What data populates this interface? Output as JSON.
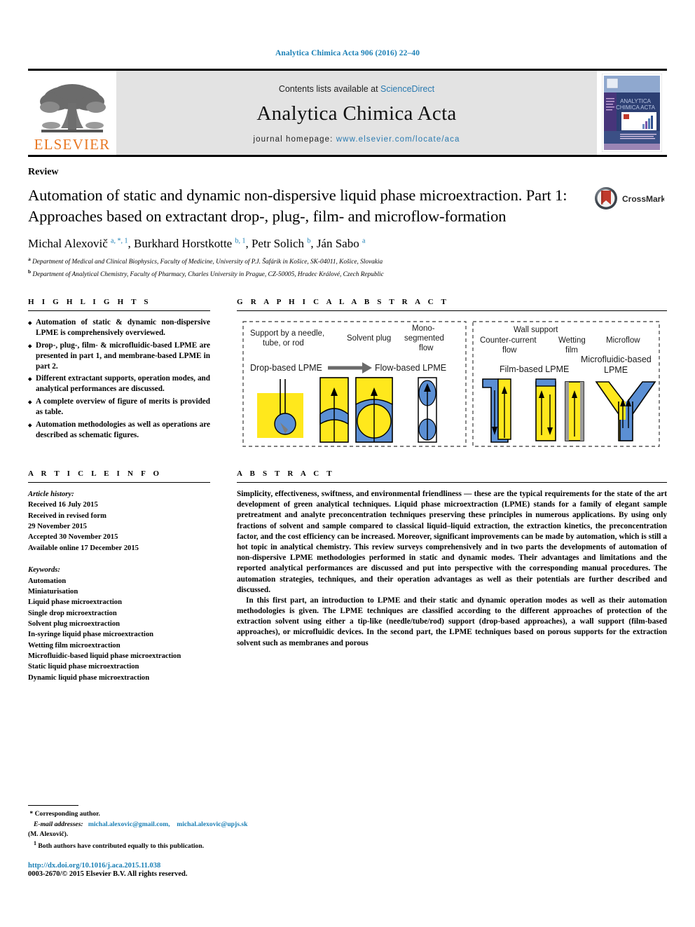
{
  "running_head": "Analytica Chimica Acta 906 (2016) 22–40",
  "masthead": {
    "publisher": "ELSEVIER",
    "contents_prefix": "Contents lists available at ",
    "contents_link": "ScienceDirect",
    "journal_name": "Analytica Chimica Acta",
    "homepage_prefix": "journal homepage: ",
    "homepage_url": "www.elsevier.com/locate/aca",
    "cover_title": "ANALYTICA CHIMICA ACTA"
  },
  "article": {
    "type_label": "Review",
    "title": "Automation of static and dynamic non-dispersive liquid phase microextraction. Part 1: Approaches based on extractant drop-, plug-, film- and microflow-formation",
    "crossmark_label": "CrossMark",
    "authors_html": "Michal Alexovič <sup>a, *, 1</sup>, Burkhard Horstkotte <sup>b, 1</sup>, Petr Solich <sup>b</sup>, Ján Sabo <sup>a</sup>",
    "affiliation_a": "Department of Medical and Clinical Biophysics, Faculty of Medicine, University of P.J. Šafárik in Košice, SK-04011, Košice, Slovakia",
    "affiliation_b": "Department of Analytical Chemistry, Faculty of Pharmacy, Charles University in Prague, CZ-50005, Hradec Králové, Czech Republic"
  },
  "highlights": {
    "heading": "H I G H L I G H T S",
    "items": [
      "Automation of static & dynamic non-dispersive LPME is comprehensively overviewed.",
      "Drop-, plug-, film- & microfluidic-based LPME are presented in part 1, and membrane-based LPME in part 2.",
      "Different extractant supports, operation modes, and analytical performances are discussed.",
      "A complete overview of figure of merits is provided as table.",
      "Automation methodologies as well as operations are described as schematic figures."
    ]
  },
  "graphical_abstract": {
    "heading": "G R A P H I C A L   A B S T R A C T",
    "left_panel": {
      "label_needle": "Support by a needle, tube, or rod",
      "label_solvent_plug": "Solvent plug",
      "label_mono": "Mono-segmented flow",
      "label_drop_based": "Drop-based LPME",
      "label_flow_based": "Flow-based LPME"
    },
    "right_panel": {
      "label_wall_support": "Wall support",
      "label_counter_current": "Counter-current flow",
      "label_wetting_film": "Wetting film",
      "label_microflow": "Microflow",
      "label_film_based": "Film-based LPME",
      "label_microfluidic": "Microfluidic-based LPME"
    },
    "colors": {
      "sample": "#FFE81C",
      "extractant": "#5B8FD4",
      "outline": "#000000"
    }
  },
  "article_info": {
    "heading": "A R T I C L E   I N F O",
    "history_label": "Article history:",
    "history": [
      "Received 16 July 2015",
      "Received in revised form",
      "29 November 2015",
      "Accepted 30 November 2015",
      "Available online 17 December 2015"
    ],
    "keywords_label": "Keywords:",
    "keywords": [
      "Automation",
      "Miniaturisation",
      "Liquid phase microextraction",
      "Single drop microextraction",
      "Solvent plug microextraction",
      "In-syringe liquid phase microextraction",
      "Wetting film microextraction",
      "Microfluidic-based liquid phase microextraction",
      "Static liquid phase microextraction",
      "Dynamic liquid phase microextraction"
    ]
  },
  "abstract": {
    "heading": "A B S T R A C T",
    "paragraphs": [
      "Simplicity, effectiveness, swiftness, and environmental friendliness — these are the typical requirements for the state of the art development of green analytical techniques. Liquid phase microextraction (LPME) stands for a family of elegant sample pretreatment and analyte preconcentration techniques preserving these principles in numerous applications. By using only fractions of solvent and sample compared to classical liquid–liquid extraction, the extraction kinetics, the preconcentration factor, and the cost efficiency can be increased. Moreover, significant improvements can be made by automation, which is still a hot topic in analytical chemistry. This review surveys comprehensively and in two parts the developments of automation of non-dispersive LPME methodologies performed in static and dynamic modes. Their advantages and limitations and the reported analytical performances are discussed and put into perspective with the corresponding manual procedures. The automation strategies, techniques, and their operation advantages as well as their potentials are further described and discussed.",
      "In this first part, an introduction to LPME and their static and dynamic operation modes as well as their automation methodologies is given. The LPME techniques are classified according to the different approaches of protection of the extraction solvent using either a tip-like (needle/tube/rod) support (drop-based approaches), a wall support (film-based approaches), or microfluidic devices. In the second part, the LPME techniques based on porous supports for the extraction solvent such as membranes and porous"
    ]
  },
  "footer": {
    "corresponding_marker": "*",
    "corresponding_label": "Corresponding author.",
    "email_label": "E-mail addresses:",
    "email_1": "michal.alexovic@gmail.com,",
    "email_2": "michal.alexovic@upjs.sk",
    "email_owner": "(M. Alexovič).",
    "footnote_marker": "1",
    "footnote_text": "Both authors have contributed equally to this publication.",
    "doi": "http://dx.doi.org/10.1016/j.aca.2015.11.038",
    "copyright": "0003-2670/© 2015 Elsevier B.V. All rights reserved."
  }
}
